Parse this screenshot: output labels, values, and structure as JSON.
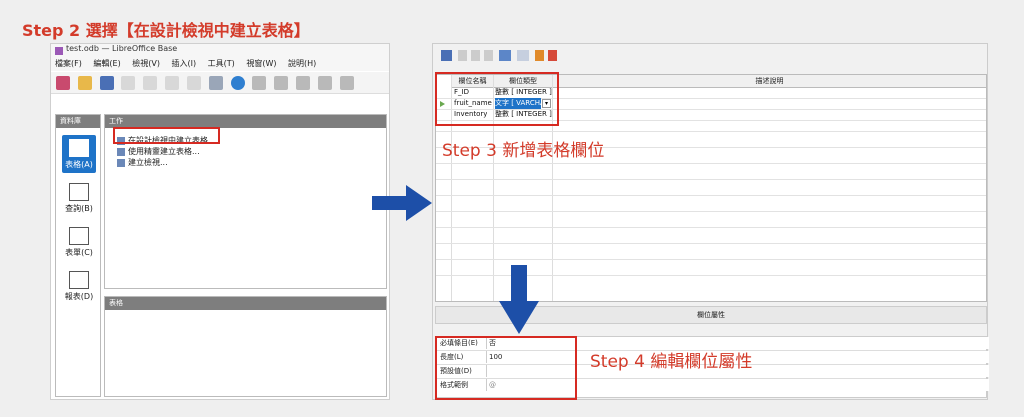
{
  "step2": "Step 2 選擇【在設計檢視中建立表格】",
  "step3": "Step 3 新增表格欄位",
  "step4": "Step 4 編輯欄位屬性",
  "left_window": {
    "title": "test.odb — LibreOffice Base",
    "menu": [
      "檔案(F)",
      "編輯(E)",
      "檢視(V)",
      "插入(I)",
      "工具(T)",
      "視窗(W)",
      "說明(H)"
    ],
    "sidebar_header": "資料庫",
    "sidebar_items": [
      "表格(A)",
      "查詢(B)",
      "表單(C)",
      "報表(D)"
    ],
    "task_header": "工作",
    "tasks": [
      "在設計檢視中建立表格...",
      "使用精靈建立表格...",
      "建立檢視..."
    ],
    "tables_header": "表格"
  },
  "right_window": {
    "columns": [
      "欄位名稱",
      "欄位類型",
      "描述說明"
    ],
    "rows": [
      {
        "name": "F_ID",
        "type": "整數 [ INTEGER ]"
      },
      {
        "name": "fruit_name",
        "type": "文字 [ VARCHA"
      },
      {
        "name": "Inventory",
        "type": "整數 [ INTEGER ]"
      }
    ],
    "props_title": "欄位屬性",
    "props": [
      {
        "label": "必填條目(E)",
        "value": "否"
      },
      {
        "label": "長度(L)",
        "value": "100"
      },
      {
        "label": "預設值(D)",
        "value": ""
      },
      {
        "label": "格式範例",
        "value": "@"
      }
    ]
  },
  "colors": {
    "accent_red": "#d62a22",
    "arrow_blue": "#1d4fa8",
    "selected_blue": "#1e73c8"
  }
}
